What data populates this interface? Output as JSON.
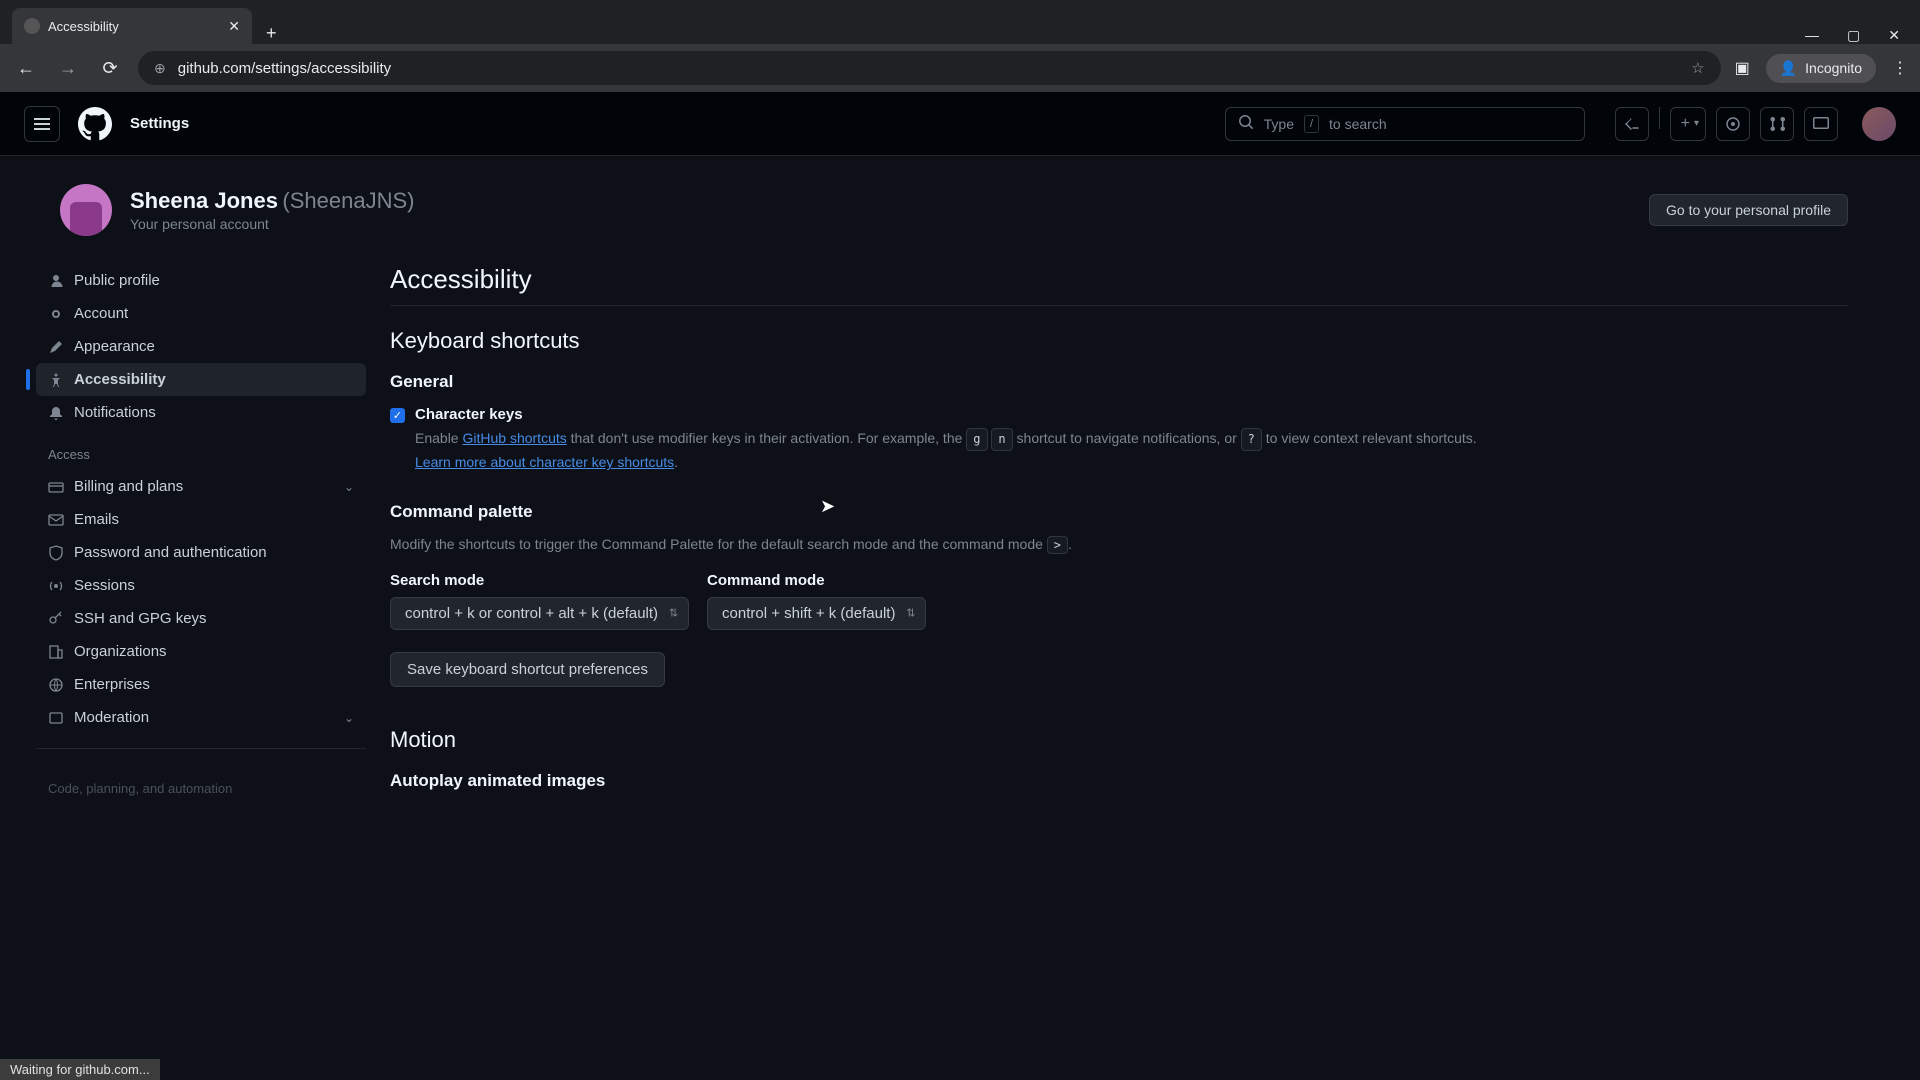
{
  "browser": {
    "tab_title": "Accessibility",
    "url": "github.com/settings/accessibility",
    "incognito_label": "Incognito",
    "status_text": "Waiting for github.com..."
  },
  "header": {
    "title": "Settings",
    "search_prefix": "Type",
    "search_key": "/",
    "search_suffix": "to search"
  },
  "profile": {
    "name": "Sheena Jones",
    "handle": "(SheenaJNS)",
    "subtitle": "Your personal account",
    "button": "Go to your personal profile"
  },
  "sidebar": {
    "items_main": [
      {
        "label": "Public profile"
      },
      {
        "label": "Account"
      },
      {
        "label": "Appearance"
      },
      {
        "label": "Accessibility"
      },
      {
        "label": "Notifications"
      }
    ],
    "heading_access": "Access",
    "items_access": [
      {
        "label": "Billing and plans",
        "expandable": true
      },
      {
        "label": "Emails"
      },
      {
        "label": "Password and authentication"
      },
      {
        "label": "Sessions"
      },
      {
        "label": "SSH and GPG keys"
      },
      {
        "label": "Organizations"
      },
      {
        "label": "Enterprises"
      },
      {
        "label": "Moderation",
        "expandable": true
      }
    ],
    "heading_code": "Code, planning, and automation"
  },
  "content": {
    "page_title": "Accessibility",
    "section_keyboard": "Keyboard shortcuts",
    "general_heading": "General",
    "charkeys_label": "Character keys",
    "charkeys_desc_1": "Enable ",
    "charkeys_link_1": "GitHub shortcuts",
    "charkeys_desc_2": " that don't use modifier keys in their activation. For example, the ",
    "charkeys_key_1": "g",
    "charkeys_key_2": "n",
    "charkeys_desc_3": " shortcut to navigate notifications, or ",
    "charkeys_key_3": "?",
    "charkeys_desc_4": " to view context relevant shortcuts. ",
    "charkeys_link_2": "Learn more about character key shortcuts",
    "cmd_heading": "Command palette",
    "cmd_desc_1": "Modify the shortcuts to trigger the Command Palette for the default search mode and the command mode ",
    "cmd_key": ">",
    "cmd_desc_2": ".",
    "search_mode_label": "Search mode",
    "search_mode_value": "control + k or control + alt + k (default)",
    "command_mode_label": "Command mode",
    "command_mode_value": "control + shift + k (default)",
    "save_button": "Save keyboard shortcut preferences",
    "motion_heading": "Motion",
    "autoplay_heading": "Autoplay animated images"
  }
}
